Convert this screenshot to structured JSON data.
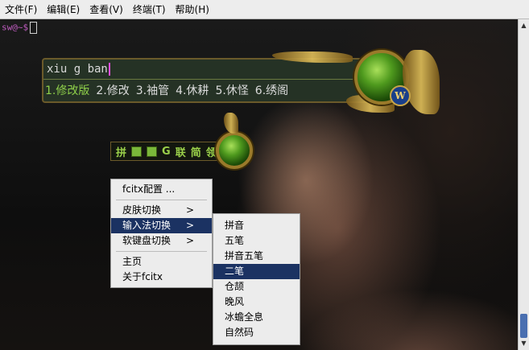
{
  "menubar": {
    "items": [
      "文件(F)",
      "编辑(E)",
      "查看(V)",
      "终端(T)",
      "帮助(H)"
    ]
  },
  "terminal": {
    "prompt": "sw@~$"
  },
  "ime": {
    "input": "xiu g ban",
    "candidates": [
      "1.修改版",
      "2.修改",
      "3.袖管",
      "4.休耕",
      "5.休怪",
      "6.绣阁"
    ],
    "badge": "W"
  },
  "statusbar": {
    "glyphs": [
      "拼",
      "G",
      "联",
      "简",
      "领"
    ]
  },
  "context_menu": {
    "items": [
      {
        "label": "fcitx配置  ...",
        "has_arrow": false
      },
      {
        "label": "皮肤切换",
        "has_arrow": true
      },
      {
        "label": "输入法切换",
        "has_arrow": true
      },
      {
        "label": "软键盘切换",
        "has_arrow": true
      },
      {
        "label": "主页",
        "has_arrow": false
      },
      {
        "label": "关于fcitx",
        "has_arrow": false
      }
    ],
    "arrow_glyph": ">"
  },
  "submenu": {
    "items": [
      "拼音",
      "五笔",
      "拼音五笔",
      "二笔",
      "仓颉",
      "晚风",
      "冰蟾全息",
      "自然码"
    ],
    "highlighted_index": 3
  },
  "colors": {
    "highlight": "#1b3262",
    "candidate_first": "#8fd04a",
    "prompt": "#c05cc0"
  }
}
